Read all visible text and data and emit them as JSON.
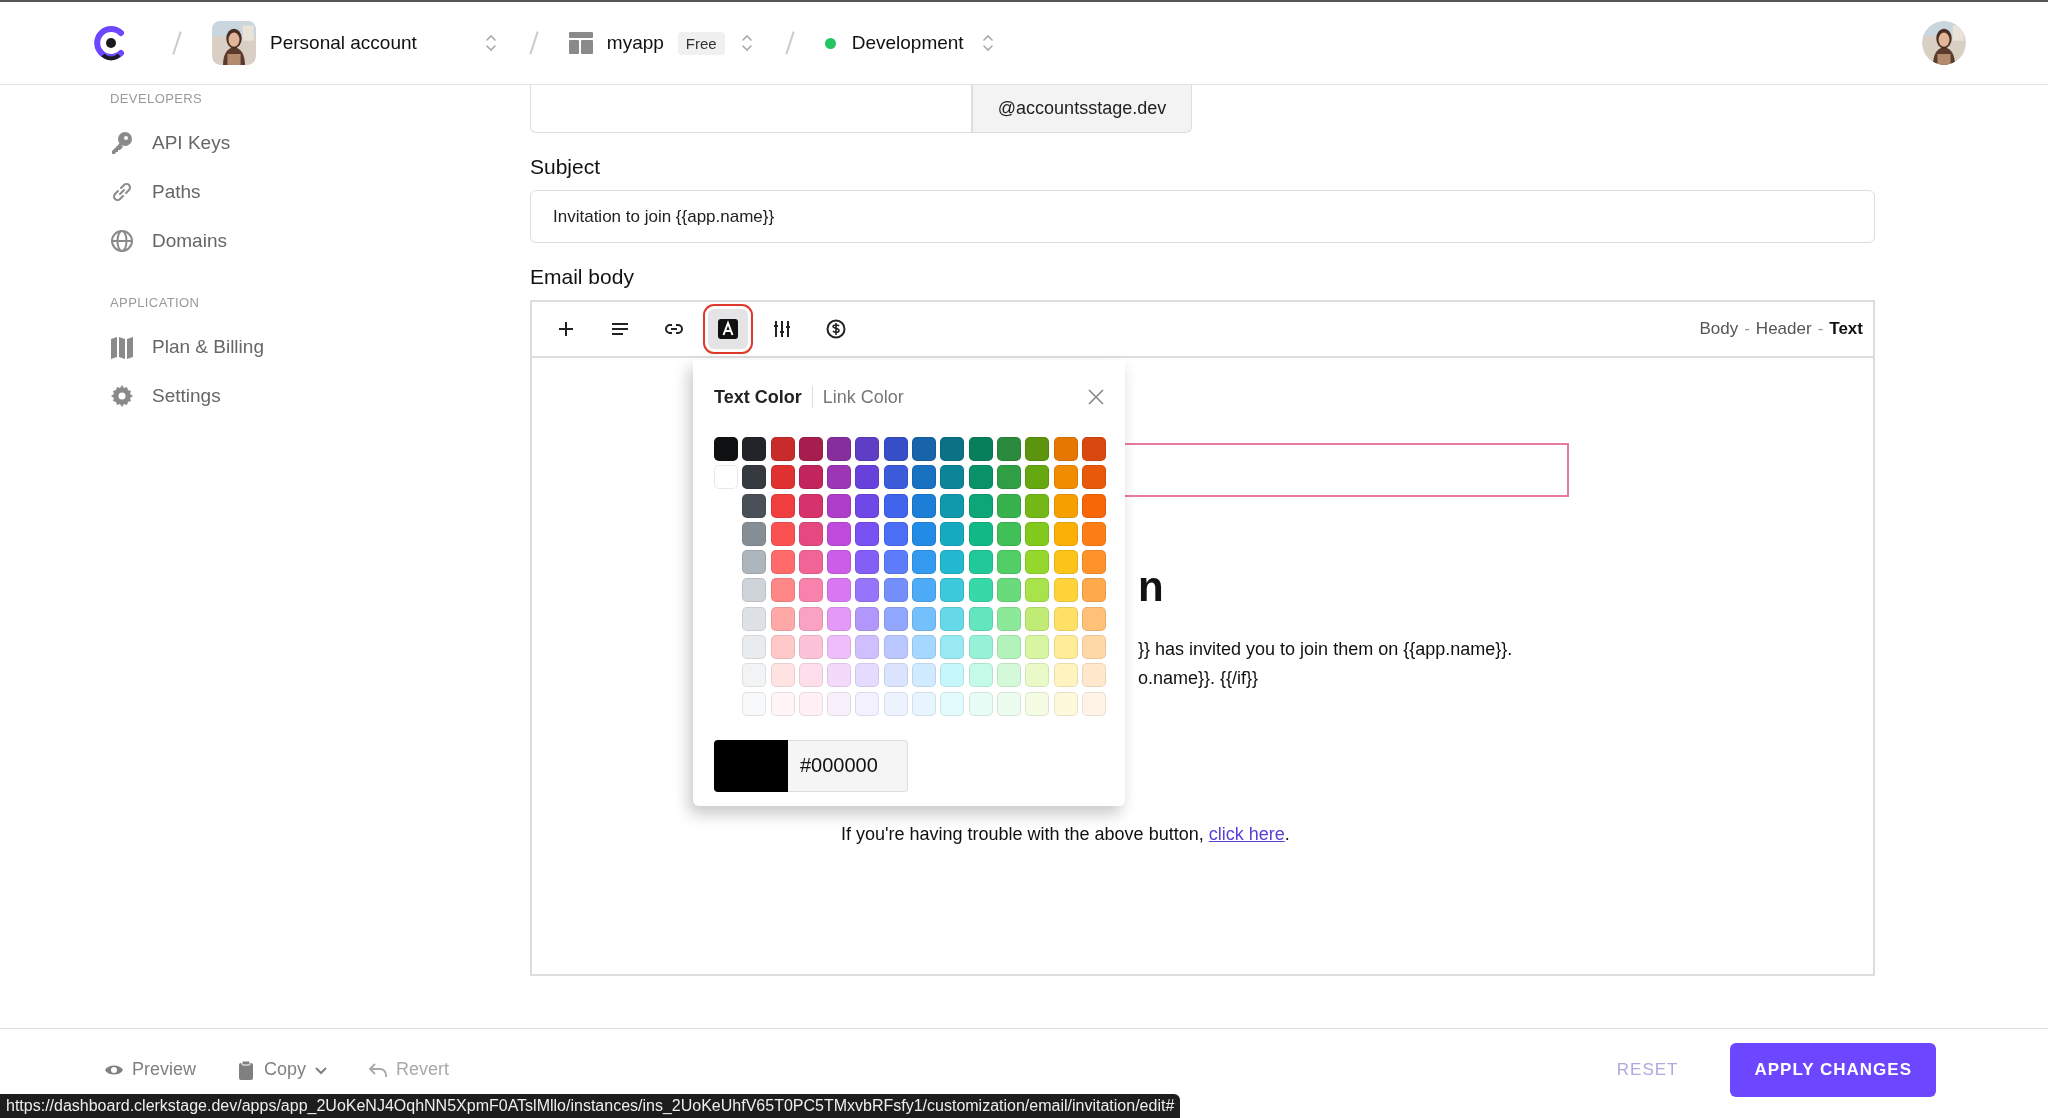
{
  "top_bar": {
    "breadcrumbs": [
      {
        "kind": "account",
        "label": "Personal account"
      },
      {
        "kind": "app",
        "label": "myapp",
        "badge": "Free"
      },
      {
        "kind": "environment",
        "label": "Development",
        "color": "#22c55e"
      }
    ]
  },
  "sidebar": {
    "sections": [
      {
        "title": "DEVELOPERS",
        "items": [
          {
            "label": "API Keys"
          },
          {
            "label": "Paths"
          },
          {
            "label": "Domains"
          }
        ]
      },
      {
        "title": "APPLICATION",
        "items": [
          {
            "label": "Plan & Billing"
          },
          {
            "label": "Settings"
          }
        ]
      }
    ]
  },
  "form": {
    "domain_suffix": "@accountsstage.dev",
    "subject": {
      "label": "Subject",
      "value": "Invitation to join {{app.name}}"
    },
    "email_body": {
      "label": "Email body",
      "tools": [
        {
          "selected": false
        },
        {
          "selected": false
        },
        {
          "selected": false
        },
        {
          "selected": true
        },
        {
          "selected": false
        },
        {
          "selected": false
        }
      ],
      "modes": [
        {
          "label": "Body",
          "selected": false
        },
        {
          "label": "Header",
          "selected": false
        },
        {
          "label": "Text",
          "selected": true
        }
      ],
      "mode_separator": "-",
      "preview": {
        "heading_tail": "n",
        "line_1": "}} has invited you to join them on {{app.name}}.",
        "line_2": "o.name}}. {{/if}}",
        "help_text": "If you're having trouble with the above button, ",
        "help_link": "click here",
        "help_end": "."
      }
    }
  },
  "color_popup": {
    "tabs": [
      {
        "label": "Text Color",
        "selected": true
      },
      {
        "label": "Link Color",
        "selected": false
      }
    ],
    "swatch_rows": [
      [
        {
          "color": "#101113"
        },
        {
          "color": "#212529"
        },
        {
          "color": "#c92a2a"
        },
        {
          "color": "#a61e4d"
        },
        {
          "color": "#862e9c"
        },
        {
          "color": "#5f3dc4"
        },
        {
          "color": "#364fc7"
        },
        {
          "color": "#1864ab"
        },
        {
          "color": "#0b7285"
        },
        {
          "color": "#087f5b"
        },
        {
          "color": "#2b8a3e"
        },
        {
          "color": "#5c940d"
        },
        {
          "color": "#e67700"
        },
        {
          "color": "#d9480f"
        }
      ],
      [
        {
          "color": "#ffffff"
        },
        {
          "color": "#343a40"
        },
        {
          "color": "#e03131"
        },
        {
          "color": "#c2255c"
        },
        {
          "color": "#9c36b5"
        },
        {
          "color": "#6741d9"
        },
        {
          "color": "#3b5bdb"
        },
        {
          "color": "#1971c2"
        },
        {
          "color": "#0c8599"
        },
        {
          "color": "#099268"
        },
        {
          "color": "#2f9e44"
        },
        {
          "color": "#66a80f"
        },
        {
          "color": "#f08c00"
        },
        {
          "color": "#e8590c"
        }
      ],
      [
        {
          "color": "#495057"
        },
        {
          "color": "#f03e3e"
        },
        {
          "color": "#d6336c"
        },
        {
          "color": "#ae3ec9"
        },
        {
          "color": "#7048e8"
        },
        {
          "color": "#4263eb"
        },
        {
          "color": "#1c7ed6"
        },
        {
          "color": "#1098ad"
        },
        {
          "color": "#0ca678"
        },
        {
          "color": "#37b24d"
        },
        {
          "color": "#74b816"
        },
        {
          "color": "#f59f00"
        },
        {
          "color": "#f76707"
        }
      ],
      [
        {
          "color": "#868e96"
        },
        {
          "color": "#fa5252"
        },
        {
          "color": "#e64980"
        },
        {
          "color": "#be4bdb"
        },
        {
          "color": "#7950f2"
        },
        {
          "color": "#4c6ef5"
        },
        {
          "color": "#228be6"
        },
        {
          "color": "#15aabf"
        },
        {
          "color": "#12b886"
        },
        {
          "color": "#40c057"
        },
        {
          "color": "#82c91e"
        },
        {
          "color": "#fab005"
        },
        {
          "color": "#fd7e14"
        }
      ],
      [
        {
          "color": "#adb5bd"
        },
        {
          "color": "#ff6b6b"
        },
        {
          "color": "#f06595"
        },
        {
          "color": "#cc5de8"
        },
        {
          "color": "#845ef7"
        },
        {
          "color": "#5c7cfa"
        },
        {
          "color": "#339af0"
        },
        {
          "color": "#22b8cf"
        },
        {
          "color": "#20c997"
        },
        {
          "color": "#51cf66"
        },
        {
          "color": "#94d82d"
        },
        {
          "color": "#fcc419"
        },
        {
          "color": "#ff922b"
        }
      ],
      [
        {
          "color": "#ced4da"
        },
        {
          "color": "#ff8787"
        },
        {
          "color": "#f783ac"
        },
        {
          "color": "#da77f2"
        },
        {
          "color": "#9775fa"
        },
        {
          "color": "#748ffc"
        },
        {
          "color": "#4dabf7"
        },
        {
          "color": "#3bc9db"
        },
        {
          "color": "#38d9a9"
        },
        {
          "color": "#69db7c"
        },
        {
          "color": "#a9e34b"
        },
        {
          "color": "#ffd43b"
        },
        {
          "color": "#ffa94d"
        }
      ],
      [
        {
          "color": "#dee2e6"
        },
        {
          "color": "#ffa8a8"
        },
        {
          "color": "#faa2c1"
        },
        {
          "color": "#e599f7"
        },
        {
          "color": "#b197fc"
        },
        {
          "color": "#91a7ff"
        },
        {
          "color": "#74c0fc"
        },
        {
          "color": "#66d9e8"
        },
        {
          "color": "#63e6be"
        },
        {
          "color": "#8ce99a"
        },
        {
          "color": "#c0eb75"
        },
        {
          "color": "#ffe066"
        },
        {
          "color": "#ffc078"
        }
      ],
      [
        {
          "color": "#e9ecef"
        },
        {
          "color": "#ffc9c9"
        },
        {
          "color": "#fcc2d7"
        },
        {
          "color": "#eebefa"
        },
        {
          "color": "#d0bfff"
        },
        {
          "color": "#bac8ff"
        },
        {
          "color": "#a5d8ff"
        },
        {
          "color": "#99e9f2"
        },
        {
          "color": "#96f2d7"
        },
        {
          "color": "#b2f2bb"
        },
        {
          "color": "#d8f5a2"
        },
        {
          "color": "#ffec99"
        },
        {
          "color": "#ffd8a8"
        }
      ],
      [
        {
          "color": "#f1f3f5"
        },
        {
          "color": "#ffe3e3"
        },
        {
          "color": "#ffdeeb"
        },
        {
          "color": "#f3d9fa"
        },
        {
          "color": "#e5dbff"
        },
        {
          "color": "#dbe4ff"
        },
        {
          "color": "#d0ebff"
        },
        {
          "color": "#c5f6fa"
        },
        {
          "color": "#c3fae8"
        },
        {
          "color": "#d3f9d8"
        },
        {
          "color": "#e9fac8"
        },
        {
          "color": "#fff3bf"
        },
        {
          "color": "#ffe8cc"
        }
      ],
      [
        {
          "color": "#f8f9fa"
        },
        {
          "color": "#fff5f5"
        },
        {
          "color": "#fff0f6"
        },
        {
          "color": "#f8f0fc"
        },
        {
          "color": "#f3f0ff"
        },
        {
          "color": "#edf2ff"
        },
        {
          "color": "#e7f5ff"
        },
        {
          "color": "#e3fafc"
        },
        {
          "color": "#e6fcf5"
        },
        {
          "color": "#ebfbee"
        },
        {
          "color": "#f4fce3"
        },
        {
          "color": "#fff9db"
        },
        {
          "color": "#fff4e6"
        }
      ]
    ],
    "hex_value": "#000000"
  },
  "bottom_bar": {
    "actions": [
      {
        "label": "Preview",
        "disabled": false
      },
      {
        "label": "Copy",
        "disabled": false
      },
      {
        "label": "Revert",
        "disabled": true
      }
    ],
    "reset": {
      "label": "RESET",
      "disabled": true
    },
    "apply": {
      "label": "APPLY CHANGES"
    }
  },
  "status_url": "https://dashboard.clerkstage.dev/apps/app_2UoKeNJ4OqhNN5XpmF0ATslMllo/instances/ins_2UoKeUhfV65T0PC5TMxvbRFsfy1/customization/email/invitation/edit#"
}
